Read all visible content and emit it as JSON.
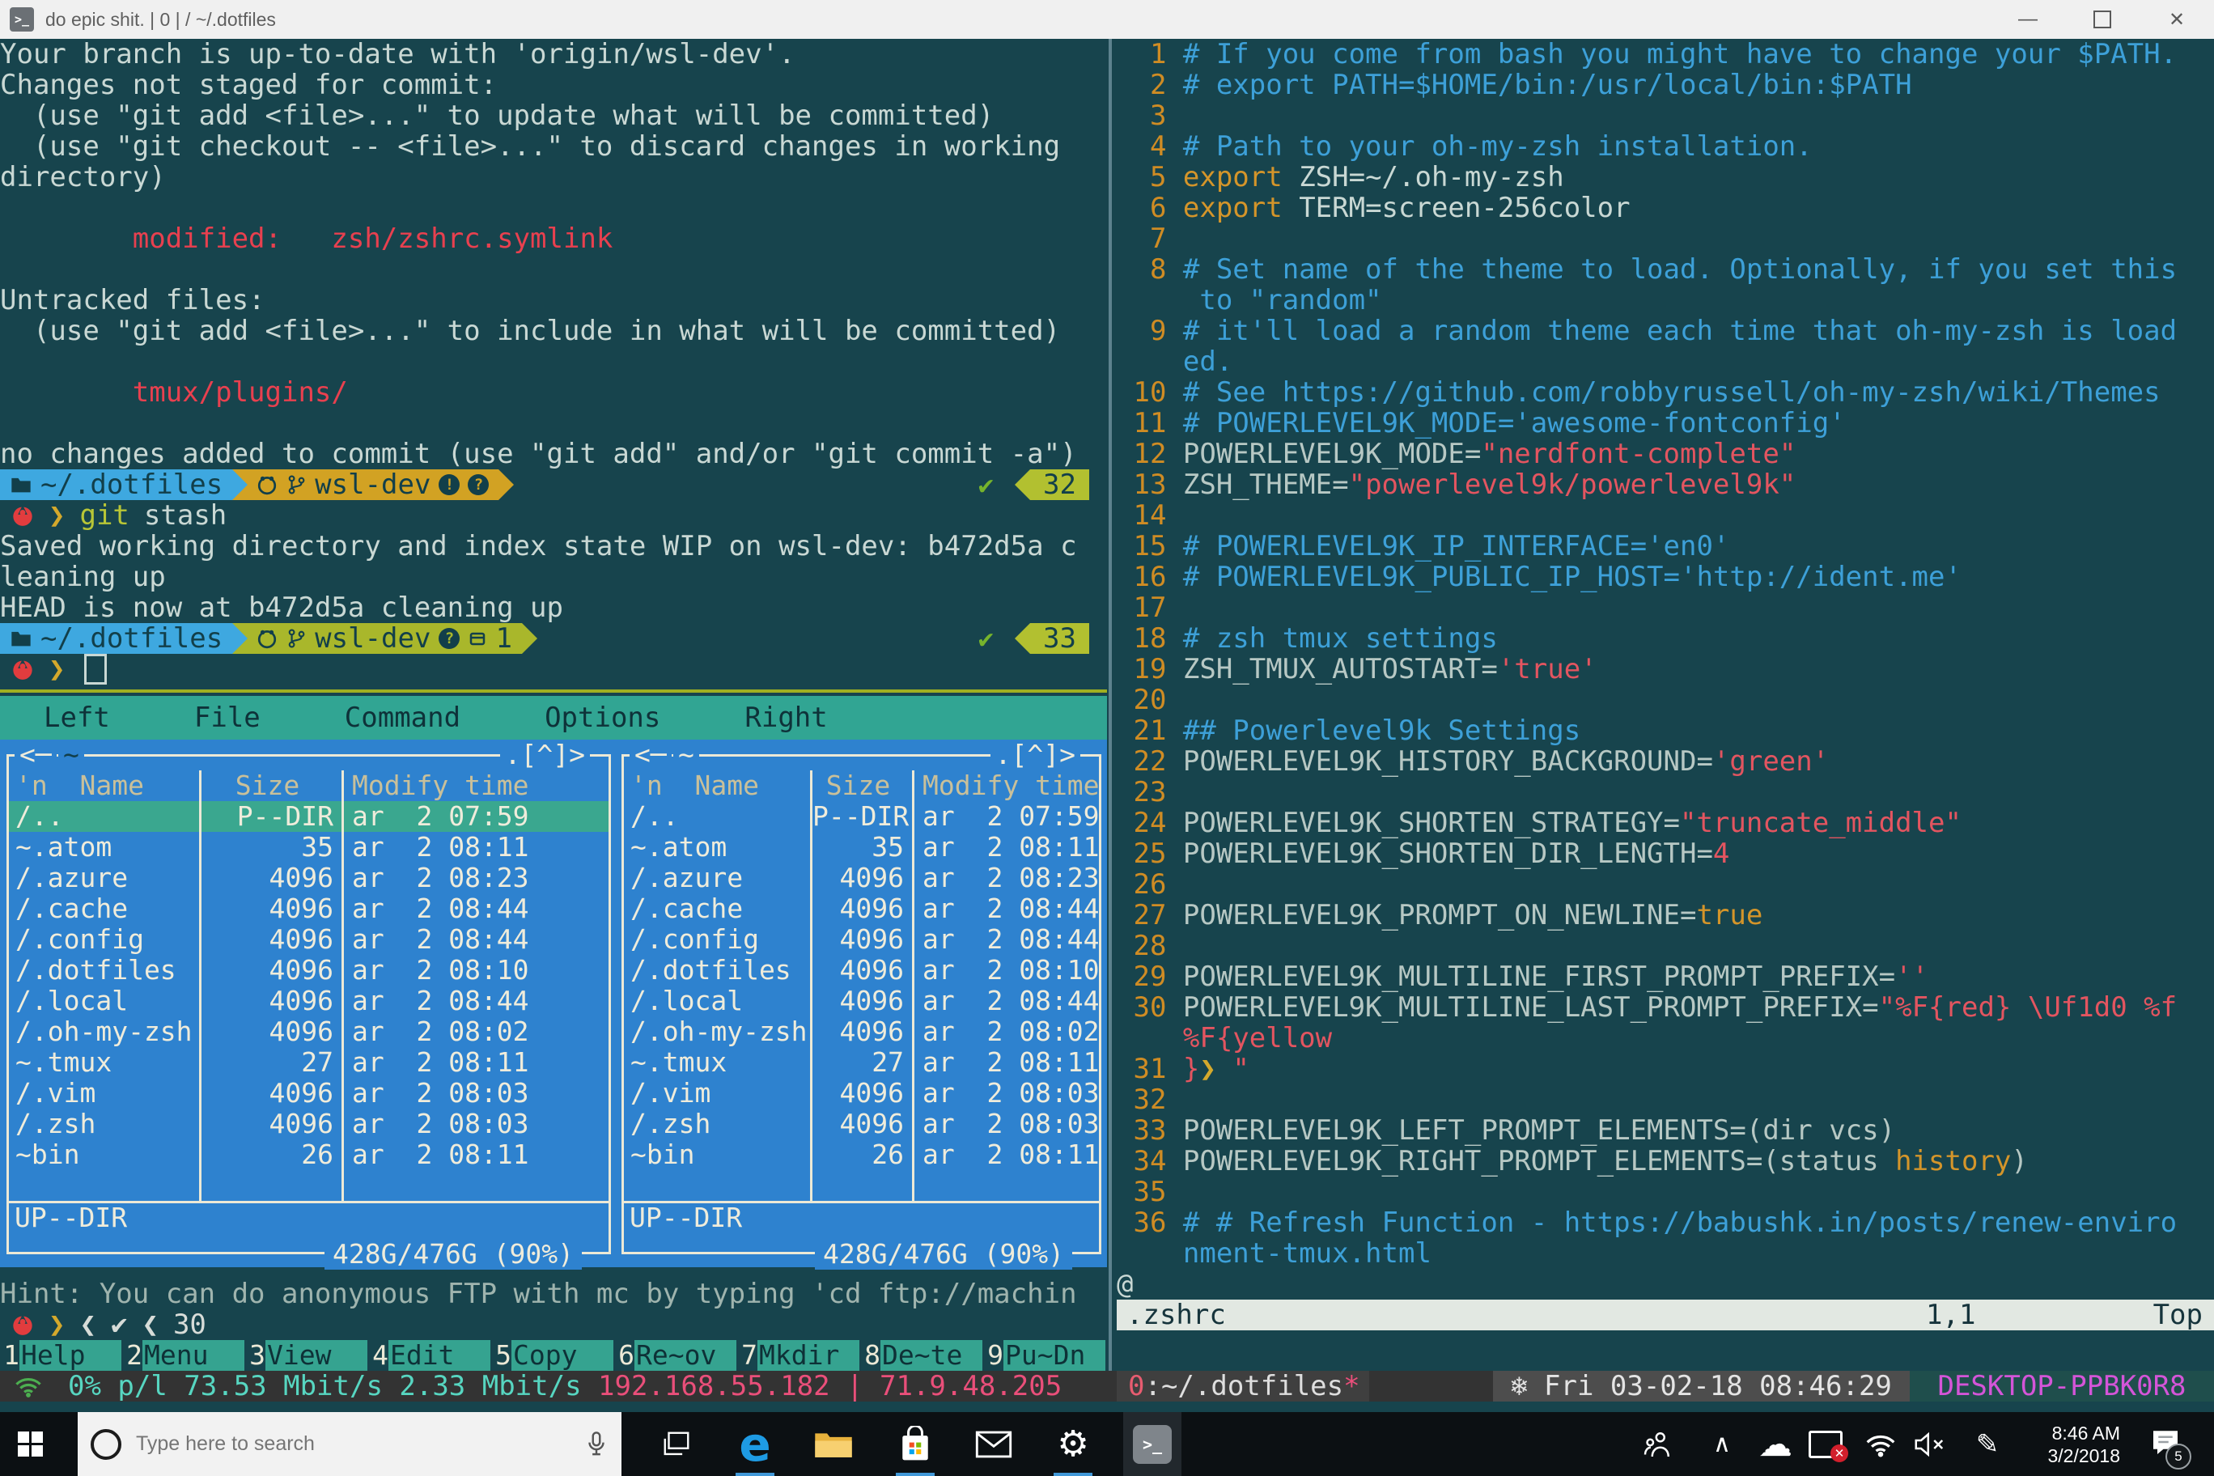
{
  "window": {
    "title": "do epic shit. | 0 | / ~/.dotfiles",
    "terminal_glyph": ">_"
  },
  "git": {
    "lines_top": [
      [
        {
          "t": "Your branch is up-to-date with 'origin/wsl-dev'."
        }
      ],
      [
        {
          "t": "Changes not staged for commit:"
        }
      ],
      [
        {
          "t": "  (use \"git add <file>...\" to update what will be committed)"
        }
      ],
      [
        {
          "t": "  (use \"git checkout -- <file>...\" to discard changes in working"
        }
      ],
      [
        {
          "t": "directory)"
        }
      ],
      [
        {
          "t": ""
        }
      ],
      [
        {
          "t": "        "
        },
        {
          "t": "modified:   zsh/zshrc.symlink",
          "c": "red"
        }
      ],
      [
        {
          "t": ""
        }
      ],
      [
        {
          "t": "Untracked files:"
        }
      ],
      [
        {
          "t": "  (use \"git add <file>...\" to include in what will be committed)"
        }
      ],
      [
        {
          "t": ""
        }
      ],
      [
        {
          "t": "        "
        },
        {
          "t": "tmux/plugins/",
          "c": "red"
        }
      ],
      [
        {
          "t": ""
        }
      ],
      [
        {
          "t": "no changes added to commit (use \"git add\" and/or \"git commit -a\")"
        }
      ]
    ],
    "lines_out": [
      [
        {
          "t": "Saved working directory and index state WIP on wsl-dev: b472d5a c"
        }
      ],
      [
        {
          "t": "leaning up"
        }
      ],
      [
        {
          "t": "HEAD is now at b472d5a cleaning up"
        }
      ]
    ]
  },
  "prompt": {
    "path": "~/.dotfiles",
    "branch": "wsl-dev",
    "dirty_mark": "!",
    "untracked_mark": "?",
    "stash_count": "1",
    "status1": "32",
    "status2": "33",
    "check": "✔",
    "arrow": "❯",
    "cmd_program": "git",
    "cmd_arg": "stash"
  },
  "mc": {
    "menu": [
      "Left",
      "File",
      "Command",
      "Options",
      "Right"
    ],
    "deco_left": "<─",
    "panel_path": "~",
    "deco_right": ".[^]>",
    "columns": {
      "name": "'n  Name",
      "size": "Size",
      "time": "Modify time"
    },
    "rows": [
      {
        "name": "/..",
        "size": "P--DIR",
        "time": "ar  2 07:59",
        "sel": true
      },
      {
        "name": "~.atom",
        "size": "35",
        "time": "ar  2 08:11"
      },
      {
        "name": "/.azure",
        "size": "4096",
        "time": "ar  2 08:23"
      },
      {
        "name": "/.cache",
        "size": "4096",
        "time": "ar  2 08:44"
      },
      {
        "name": "/.config",
        "size": "4096",
        "time": "ar  2 08:44"
      },
      {
        "name": "/.dotfiles",
        "size": "4096",
        "time": "ar  2 08:10"
      },
      {
        "name": "/.local",
        "size": "4096",
        "time": "ar  2 08:44"
      },
      {
        "name": "/.oh-my-zsh",
        "size": "4096",
        "time": "ar  2 08:02"
      },
      {
        "name": "~.tmux",
        "size": "27",
        "time": "ar  2 08:11"
      },
      {
        "name": "/.vim",
        "size": "4096",
        "time": "ar  2 08:03"
      },
      {
        "name": "/.zsh",
        "size": "4096",
        "time": "ar  2 08:03"
      },
      {
        "name": "~bin",
        "size": "26",
        "time": "ar  2 08:11"
      },
      {
        "name": "",
        "size": "",
        "time": ""
      }
    ],
    "updir": "UP--DIR",
    "disk": "428G/476G (90%)",
    "hint": "Hint: You can do anonymous FTP with mc by typing 'cd ftp://machin",
    "prompt_segs": [
      "❮",
      "✔",
      "❮",
      "30"
    ],
    "fkeys": [
      {
        "n": "1",
        "l": "Help"
      },
      {
        "n": "2",
        "l": "Menu"
      },
      {
        "n": "3",
        "l": "View"
      },
      {
        "n": "4",
        "l": "Edit"
      },
      {
        "n": "5",
        "l": "Copy"
      },
      {
        "n": "6",
        "l": "Re~ov"
      },
      {
        "n": "7",
        "l": "Mkdir"
      },
      {
        "n": "8",
        "l": "De~te"
      },
      {
        "n": "9",
        "l": "Pu~Dn"
      }
    ]
  },
  "vim": {
    "lines": [
      [
        {
          "t": "  1 ",
          "c": "n"
        },
        {
          "t": "# If you come from bash you might have to change your $PATH.",
          "c": "c"
        }
      ],
      [
        {
          "t": "  2 ",
          "c": "n"
        },
        {
          "t": "# export PATH=$HOME/bin:/usr/local/bin:$PATH",
          "c": "c"
        }
      ],
      [
        {
          "t": "  3",
          "c": "n"
        }
      ],
      [
        {
          "t": "  4 ",
          "c": "n"
        },
        {
          "t": "# Path to your oh-my-zsh installation.",
          "c": "c"
        }
      ],
      [
        {
          "t": "  5 ",
          "c": "n"
        },
        {
          "t": "export",
          "c": "o"
        },
        {
          "t": " ZSH=~/.oh-my-zsh",
          "c": "p"
        }
      ],
      [
        {
          "t": "  6 ",
          "c": "n"
        },
        {
          "t": "export",
          "c": "o"
        },
        {
          "t": " TERM=screen-256color",
          "c": "p"
        }
      ],
      [
        {
          "t": "  7",
          "c": "n"
        }
      ],
      [
        {
          "t": "  8 ",
          "c": "n"
        },
        {
          "t": "# Set name of the theme to load. Optionally, if you set this",
          "c": "c"
        }
      ],
      [
        {
          "t": "     to \"random\"",
          "c": "c"
        }
      ],
      [
        {
          "t": "  9 ",
          "c": "n"
        },
        {
          "t": "# it'll load a random theme each time that oh-my-zsh is load",
          "c": "c"
        }
      ],
      [
        {
          "t": "    ed.",
          "c": "c"
        }
      ],
      [
        {
          "t": " 10 ",
          "c": "n"
        },
        {
          "t": "# See https://github.com/robbyrussell/oh-my-zsh/wiki/Themes",
          "c": "c"
        }
      ],
      [
        {
          "t": " 11 ",
          "c": "n"
        },
        {
          "t": "# POWERLEVEL9K_MODE='awesome-fontconfig'",
          "c": "c"
        }
      ],
      [
        {
          "t": " 12 ",
          "c": "n"
        },
        {
          "t": "POWERLEVEL9K_MODE=",
          "c": "v"
        },
        {
          "t": "\"nerdfont-complete\"",
          "c": "s"
        }
      ],
      [
        {
          "t": " 13 ",
          "c": "n"
        },
        {
          "t": "ZSH_THEME=",
          "c": "v"
        },
        {
          "t": "\"powerlevel9k/powerlevel9k\"",
          "c": "s"
        }
      ],
      [
        {
          "t": " 14",
          "c": "n"
        }
      ],
      [
        {
          "t": " 15 ",
          "c": "n"
        },
        {
          "t": "# POWERLEVEL9K_IP_INTERFACE='en0'",
          "c": "c"
        }
      ],
      [
        {
          "t": " 16 ",
          "c": "n"
        },
        {
          "t": "# POWERLEVEL9K_PUBLIC_IP_HOST='http://ident.me'",
          "c": "c"
        }
      ],
      [
        {
          "t": " 17",
          "c": "n"
        }
      ],
      [
        {
          "t": " 18 ",
          "c": "n"
        },
        {
          "t": "# zsh tmux settings",
          "c": "c"
        }
      ],
      [
        {
          "t": " 19 ",
          "c": "n"
        },
        {
          "t": "ZSH_TMUX_AUTOSTART=",
          "c": "v"
        },
        {
          "t": "'true'",
          "c": "s"
        }
      ],
      [
        {
          "t": " 20",
          "c": "n"
        }
      ],
      [
        {
          "t": " 21 ",
          "c": "n"
        },
        {
          "t": "## Powerlevel9k Settings",
          "c": "c"
        }
      ],
      [
        {
          "t": " 22 ",
          "c": "n"
        },
        {
          "t": "POWERLEVEL9K_HISTORY_BACKGROUND=",
          "c": "v"
        },
        {
          "t": "'green'",
          "c": "s"
        }
      ],
      [
        {
          "t": " 23",
          "c": "n"
        }
      ],
      [
        {
          "t": " 24 ",
          "c": "n"
        },
        {
          "t": "POWERLEVEL9K_SHORTEN_STRATEGY=",
          "c": "v"
        },
        {
          "t": "\"truncate_middle\"",
          "c": "s"
        }
      ],
      [
        {
          "t": " 25 ",
          "c": "n"
        },
        {
          "t": "POWERLEVEL9K_SHORTEN_DIR_LENGTH=",
          "c": "v"
        },
        {
          "t": "4",
          "c": "s"
        }
      ],
      [
        {
          "t": " 26",
          "c": "n"
        }
      ],
      [
        {
          "t": " 27 ",
          "c": "n"
        },
        {
          "t": "POWERLEVEL9K_PROMPT_ON_NEWLINE=",
          "c": "v"
        },
        {
          "t": "true",
          "c": "o"
        }
      ],
      [
        {
          "t": " 28",
          "c": "n"
        }
      ],
      [
        {
          "t": " 29 ",
          "c": "n"
        },
        {
          "t": "POWERLEVEL9K_MULTILINE_FIRST_PROMPT_PREFIX=",
          "c": "v"
        },
        {
          "t": "''",
          "c": "s"
        }
      ],
      [
        {
          "t": " 30 ",
          "c": "n"
        },
        {
          "t": "POWERLEVEL9K_MULTILINE_LAST_PROMPT_PREFIX=",
          "c": "v"
        },
        {
          "t": "\"%F{red} \\Uf1d0 %f",
          "c": "s"
        }
      ],
      [
        {
          "t": "    ",
          "c": "p"
        },
        {
          "t": "%F{yellow",
          "c": "s"
        }
      ],
      [
        {
          "t": " 31 ",
          "c": "n"
        },
        {
          "t": "}",
          "c": "s"
        },
        {
          "t": "❯",
          "c": "y"
        },
        {
          "t": " \"",
          "c": "s"
        }
      ],
      [
        {
          "t": " 32",
          "c": "n"
        }
      ],
      [
        {
          "t": " 33 ",
          "c": "n"
        },
        {
          "t": "POWERLEVEL9K_LEFT_PROMPT_ELEMENTS=(dir vcs)",
          "c": "v"
        }
      ],
      [
        {
          "t": " 34 ",
          "c": "n"
        },
        {
          "t": "POWERLEVEL9K_RIGHT_PROMPT_ELEMENTS=(status ",
          "c": "v"
        },
        {
          "t": "history",
          "c": "o"
        },
        {
          "t": ")",
          "c": "v"
        }
      ],
      [
        {
          "t": " 35",
          "c": "n"
        }
      ],
      [
        {
          "t": " 36 ",
          "c": "n"
        },
        {
          "t": "# # Refresh Function - https://babushk.in/posts/renew-enviro",
          "c": "c"
        }
      ],
      [
        {
          "t": "    nment-tmux.html",
          "c": "c"
        }
      ],
      [
        {
          "t": "@",
          "c": "p"
        }
      ]
    ],
    "status": {
      "file": ".zshrc",
      "position": "1,1",
      "scroll": "Top"
    }
  },
  "tmux": {
    "net_stats": "0% p/l 73.53 Mbit/s 2.33 Mbit/s ",
    "ips": "192.168.55.182 | 71.9.48.205",
    "window_index": "0",
    "window_name": ":~/.dotfiles",
    "window_flag": "*",
    "date": "❄ Fri 03-02-18  08:46:29",
    "host": "DESKTOP-PPBK0R8"
  },
  "taskbar": {
    "search_placeholder": "Type here to search",
    "terminal_glyph": ">_",
    "edge_glyph": "e",
    "gear_glyph": "⚙",
    "chevron_glyph": "∧",
    "cloud_glyph": "☁",
    "pen_glyph": "✎",
    "clock_time": "8:46 AM",
    "clock_date": "3/2/2018",
    "notification_count": "5"
  },
  "colors": {
    "terminal_bg": "#17444d",
    "powerline_blue": "#3ea8e0",
    "powerline_gold": "#d2a223",
    "powerline_olive": "#a9b72b",
    "mc_blue": "#2e82cf",
    "mc_teal": "#31a593",
    "accent_red": "#e8404f"
  }
}
